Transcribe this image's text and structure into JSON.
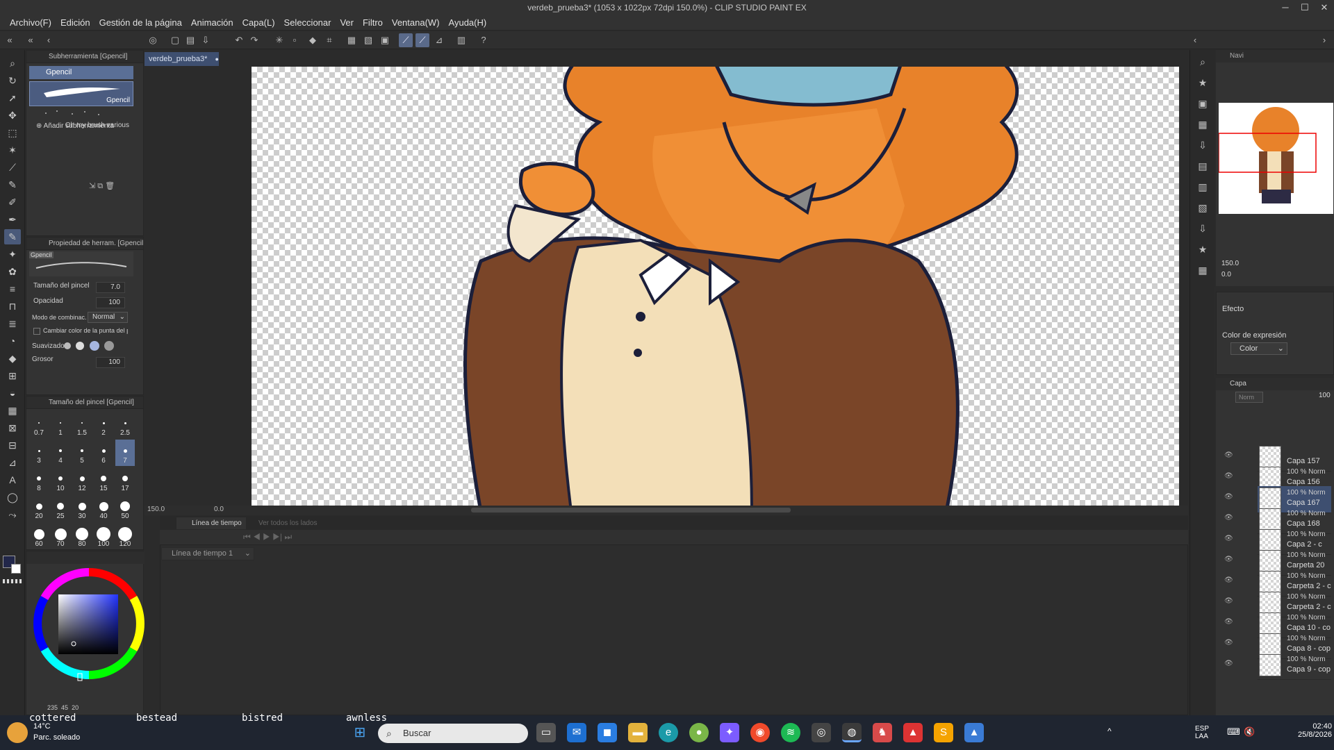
{
  "window": {
    "title": "verdeb_prueba3* (1053 x 1022px 72dpi 150.0%) - CLIP STUDIO PAINT EX",
    "minimize": "─",
    "maximize": "☐",
    "close": "✕"
  },
  "menu": [
    "Archivo(F)",
    "Edición",
    "Gestión de la página",
    "Animación",
    "Capa(L)",
    "Seleccionar",
    "Ver",
    "Filtro",
    "Ventana(W)",
    "Ayuda(H)"
  ],
  "subtool_panel": {
    "header": "Subherramienta [Gpencil]",
    "selected_group": "Gpencil",
    "brush_preview_label": "Gpencil",
    "brush_name": "Oh my brush various",
    "add_label": "Añadir subherramienta"
  },
  "tool_property": {
    "header": "Propiedad de herram. [Gpencil]",
    "preview_label": "Gpencil",
    "brush_size_label": "Tamaño del pincel",
    "brush_size_value": "7.0",
    "opacity_label": "Opacidad",
    "opacity_value": "100",
    "blend_label": "Modo de combinac.",
    "blend_value": "Normal",
    "tip_color_label": "Cambiar color de la punta del pincel",
    "smoothing_label": "Suavizado",
    "thickness_label": "Grosor",
    "thickness_value": "100"
  },
  "brush_size_panel": {
    "header": "Tamaño del pincel [Gpencil]",
    "sizes": [
      "0.7",
      "1",
      "1.5",
      "2",
      "2.5",
      "3",
      "4",
      "5",
      "6",
      "7",
      "8",
      "10",
      "12",
      "15",
      "17",
      "20",
      "25",
      "30",
      "40",
      "50",
      "60",
      "70",
      "80",
      "100",
      "120"
    ],
    "selected": "7"
  },
  "color": {
    "main": "#22274a",
    "sub": "#ffffff",
    "hsv": [
      "235",
      "45",
      "20"
    ]
  },
  "document_tab": "verdeb_prueba3*",
  "canvas_status": {
    "zoom": "150.0",
    "angle": "0.0"
  },
  "timeline": {
    "tab1": "Línea de tiempo",
    "tab2": "Ver todos los lados",
    "select": "Línea de tiempo 1"
  },
  "navigator": {
    "tab": "Navi",
    "zoom": "150.0",
    "angle": "0.0",
    "effect_label": "Efecto",
    "expression_label": "Color de expresión",
    "expression_value": "Color"
  },
  "layers": {
    "tab": "Capa",
    "blend": "Norm",
    "opacity": "100",
    "items": [
      {
        "mode": "",
        "name": "Capa 157"
      },
      {
        "mode": "100 % Norm",
        "name": "Capa 156"
      },
      {
        "mode": "100 % Norm",
        "name": "Capa 167"
      },
      {
        "mode": "100 % Norm",
        "name": "Capa 168"
      },
      {
        "mode": "100 % Norm",
        "name": "Capa 2 - c"
      },
      {
        "mode": "100 % Norm",
        "name": "Carpeta 20"
      },
      {
        "mode": "100 % Norm",
        "name": "Carpeta 2 - c"
      },
      {
        "mode": "100 % Norm",
        "name": "Carpeta 2 - c"
      },
      {
        "mode": "100 % Norm",
        "name": "Capa 10 - co"
      },
      {
        "mode": "100 % Norm",
        "name": "Capa 8 - cop"
      },
      {
        "mode": "100 % Norm",
        "name": "Capa 9 - cop"
      }
    ]
  },
  "taskbar": {
    "weather_temp": "14°C",
    "weather_desc": "Parc. soleado",
    "search_placeholder": "Buscar",
    "overlay_text": [
      "cottered",
      "bestead",
      "bistred",
      "awnless"
    ],
    "lang": "ESP",
    "lang2": "LAA",
    "time": "02:40",
    "date": "25/8/2026"
  }
}
